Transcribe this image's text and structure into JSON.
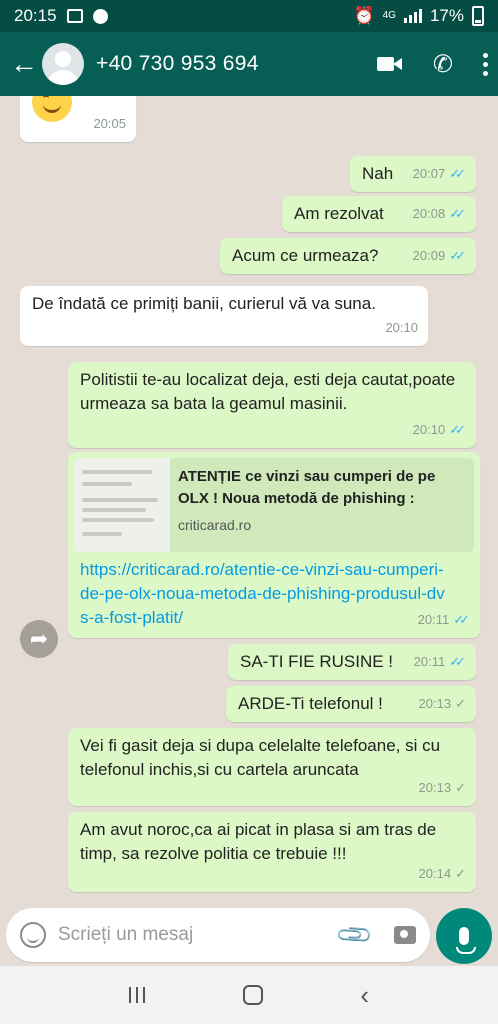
{
  "status_bar": {
    "time": "20:15",
    "network": "4G",
    "battery": "17%"
  },
  "header": {
    "contact": "+40 730 953 694",
    "icons": [
      "back-arrow-icon",
      "avatar",
      "video-call-icon",
      "phone-icon",
      "menu-icon"
    ]
  },
  "messages": [
    {
      "dir": "in",
      "text": "",
      "emoji": "smiling-face",
      "time": "20:05"
    },
    {
      "dir": "out",
      "text": "Nah",
      "time": "20:07",
      "status": "read"
    },
    {
      "dir": "out",
      "text": "Am rezolvat",
      "time": "20:08",
      "status": "read"
    },
    {
      "dir": "out",
      "text": "Acum ce urmeaza?",
      "time": "20:09",
      "status": "read"
    },
    {
      "dir": "in",
      "text": "De îndată ce primiți banii, curierul vă va suna.",
      "time": "20:10"
    },
    {
      "dir": "out",
      "text": "Politistii te-au localizat deja, esti deja cautat,poate urmeaza sa bata la geamul masinii.",
      "time": "20:10",
      "status": "read"
    },
    {
      "dir": "out",
      "preview_title": "ATENȚIE ce vinzi sau cumperi de pe OLX ! Noua metodă de phishing : „Produsul dvs a fost plătit” ! | Critic ...",
      "preview_domain": "criticarad.ro",
      "text": "https://criticarad.ro/atentie-ce-vinzi-sau-cumperi-de-pe-olx-noua-metoda-de-phishing-produsul-dvs-a-fost-platit/",
      "time": "20:11",
      "status": "read"
    },
    {
      "dir": "out",
      "text": "SA-TI FIE RUSINE !",
      "time": "20:11",
      "status": "read"
    },
    {
      "dir": "out",
      "text": "ARDE-Ti telefonul !",
      "time": "20:13",
      "status": "sent"
    },
    {
      "dir": "out",
      "text": "Vei fi gasit deja si dupa celelalte telefoane, si cu telefonul inchis,si cu cartela aruncata",
      "time": "20:13",
      "status": "sent"
    },
    {
      "dir": "out",
      "text": "Am avut noroc,ca ai picat in plasa si am tras de timp, sa rezolve politia ce trebuie !!!",
      "time": "20:14",
      "status": "sent"
    }
  ],
  "composer": {
    "placeholder": "Scrieți un mesaj"
  },
  "colors": {
    "header": "#075e54",
    "status_bar": "#054d44",
    "outgoing": "#dcf8c6",
    "incoming": "#ffffff",
    "read_tick": "#34b7f1",
    "mic_button": "#00897b"
  }
}
